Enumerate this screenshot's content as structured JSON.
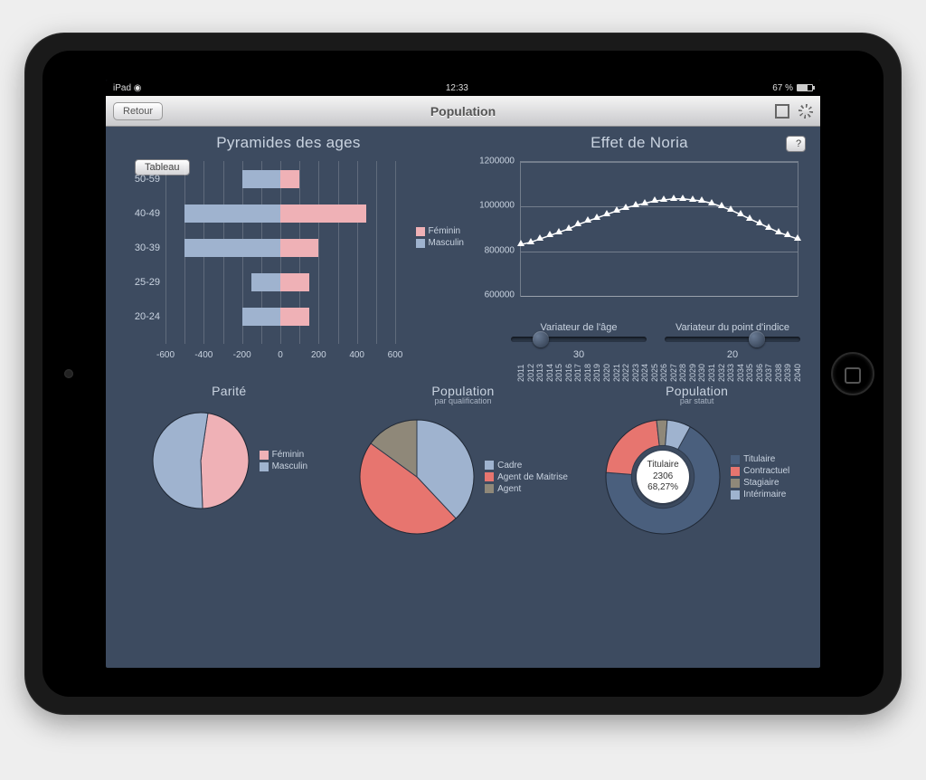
{
  "device": {
    "carrier": "iPad",
    "wifi_icon": "wifi-icon",
    "clock": "12:33",
    "battery_pct": "67 %"
  },
  "navbar": {
    "back": "Retour",
    "title": "Population",
    "fullscreen_icon": "fullscreen-icon",
    "settings_icon": "gear-icon"
  },
  "pyramid": {
    "title": "Pyramides des ages",
    "tableau_btn": "Tableau",
    "legend": {
      "f": "Féminin",
      "m": "Masculin"
    },
    "x_ticks": [
      -600,
      -400,
      -200,
      0,
      200,
      400,
      600
    ]
  },
  "noria": {
    "title": "Effet de Noria",
    "help": "?",
    "y_ticks": [
      600000,
      800000,
      1000000,
      1200000
    ],
    "slider_age": {
      "label": "Variateur de l'âge",
      "value": 30,
      "pos": 0.22
    },
    "slider_indice": {
      "label": "Variateur du point d'indice",
      "value": 20,
      "pos": 0.68
    }
  },
  "parite": {
    "title": "Parité",
    "legend": {
      "f": "Féminin",
      "m": "Masculin"
    }
  },
  "pop_qualif": {
    "title": "Population",
    "sub": "par qualification",
    "legend": [
      "Cadre",
      "Agent de Maitrise",
      "Agent"
    ]
  },
  "pop_statut": {
    "title": "Population",
    "sub": "par statut",
    "legend": [
      "Titulaire",
      "Contractuel",
      "Stagiaire",
      "Intérimaire"
    ],
    "callout": {
      "label": "Titulaire",
      "count": "2306",
      "pct": "68,27%"
    }
  },
  "chart_data": [
    {
      "type": "bar",
      "title": "Pyramides des ages",
      "orientation": "horizontal-diverging",
      "categories": [
        "50-59",
        "40-49",
        "30-39",
        "25-29",
        "20-24"
      ],
      "series": [
        {
          "name": "Masculin",
          "values": [
            -200,
            -500,
            -500,
            -150,
            -200
          ]
        },
        {
          "name": "Féminin",
          "values": [
            100,
            450,
            200,
            150,
            150
          ]
        }
      ],
      "xlim": [
        -600,
        600
      ],
      "xlabel": "",
      "ylabel": ""
    },
    {
      "type": "line",
      "title": "Effet de Noria",
      "x": [
        2011,
        2012,
        2013,
        2014,
        2015,
        2016,
        2017,
        2018,
        2019,
        2020,
        2021,
        2022,
        2023,
        2024,
        2025,
        2026,
        2027,
        2028,
        2029,
        2030,
        2031,
        2032,
        2033,
        2034,
        2035,
        2036,
        2037,
        2038,
        2039,
        2040
      ],
      "series": [
        {
          "name": "Effet de Noria",
          "values": [
            830000,
            840000,
            855000,
            870000,
            885000,
            900000,
            920000,
            935000,
            950000,
            965000,
            980000,
            995000,
            1005000,
            1015000,
            1025000,
            1030000,
            1035000,
            1035000,
            1030000,
            1025000,
            1015000,
            1000000,
            985000,
            965000,
            945000,
            925000,
            905000,
            885000,
            870000,
            855000
          ]
        }
      ],
      "ylim": [
        600000,
        1200000
      ],
      "xlabel": "",
      "ylabel": ""
    },
    {
      "type": "pie",
      "title": "Parité",
      "categories": [
        "Féminin",
        "Masculin"
      ],
      "values": [
        47,
        53
      ]
    },
    {
      "type": "pie",
      "title": "Population par qualification",
      "categories": [
        "Cadre",
        "Agent de Maitrise",
        "Agent"
      ],
      "values": [
        38,
        47,
        15
      ]
    },
    {
      "type": "pie",
      "title": "Population par statut",
      "subtype": "donut",
      "categories": [
        "Titulaire",
        "Contractuel",
        "Stagiaire",
        "Intérimaire"
      ],
      "values": [
        68.27,
        22,
        3,
        6.73
      ],
      "annotations": [
        {
          "label": "Titulaire",
          "count": 2306,
          "pct": 68.27
        }
      ]
    }
  ]
}
